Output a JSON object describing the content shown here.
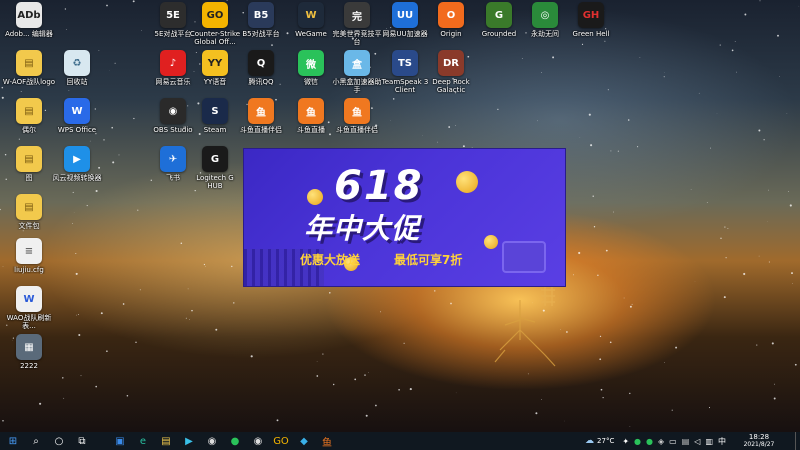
{
  "desktop": {
    "icons": [
      {
        "label": "Adob... 编辑器",
        "color": "#e8e8e8",
        "glyph": "ADb",
        "text": "#222"
      },
      {
        "label": "5E对战平台",
        "color": "#2d2d2d",
        "glyph": "5E",
        "text": "#fff"
      },
      {
        "label": "Counter-Strike Global Off...",
        "color": "#f4b400",
        "glyph": "GO",
        "text": "#222"
      },
      {
        "label": "B5对战平台",
        "color": "#2a3a5a",
        "glyph": "B5",
        "text": "#fff"
      },
      {
        "label": "WeGame",
        "color": "#1e2a3a",
        "glyph": "W",
        "text": "#f0c040"
      },
      {
        "label": "完美世界竞技平台",
        "color": "#3a3a3a",
        "glyph": "完",
        "text": "#fff"
      },
      {
        "label": "网易UU加速器",
        "color": "#1e6fd8",
        "glyph": "UU",
        "text": "#fff"
      },
      {
        "label": "Origin",
        "color": "#f26b1d",
        "glyph": "O",
        "text": "#fff"
      },
      {
        "label": "Grounded",
        "color": "#3a7a2a",
        "glyph": "G",
        "text": "#fff"
      },
      {
        "label": "永劫无间",
        "color": "#2a8a3a",
        "glyph": "◎",
        "text": "#fff"
      },
      {
        "label": "Green Hell",
        "color": "#1a1a1a",
        "glyph": "GH",
        "text": "#e03030"
      },
      {
        "label": "W-AOF战队logo",
        "color": "#f2c94c",
        "glyph": "▤",
        "text": "#7a5a10"
      },
      {
        "label": "回收站",
        "color": "#d8e8f0",
        "glyph": "♻",
        "text": "#3a6a8a"
      },
      {
        "label": "网易云音乐",
        "color": "#e02020",
        "glyph": "♪",
        "text": "#fff"
      },
      {
        "label": "YY语音",
        "color": "#f4c020",
        "glyph": "YY",
        "text": "#222"
      },
      {
        "label": "腾讯QQ",
        "color": "#1a1a1a",
        "glyph": "Q",
        "text": "#fff"
      },
      {
        "label": "微信",
        "color": "#2ac25a",
        "glyph": "微",
        "text": "#fff"
      },
      {
        "label": "小黑盒加速器助手",
        "color": "#6ab8e8",
        "glyph": "盒",
        "text": "#fff"
      },
      {
        "label": "TeamSpeak 3 Client",
        "color": "#2a4a8a",
        "glyph": "TS",
        "text": "#fff"
      },
      {
        "label": "Deep Rock Galactic",
        "color": "#8a3a2a",
        "glyph": "DR",
        "text": "#fff"
      },
      {
        "label": "偶尔",
        "color": "#f2c94c",
        "glyph": "▤",
        "text": "#7a5a10"
      },
      {
        "label": "WPS Office",
        "color": "#2a6ae8",
        "glyph": "W",
        "text": "#fff"
      },
      {
        "label": "OBS Studio",
        "color": "#2a2a2a",
        "glyph": "◉",
        "text": "#fff"
      },
      {
        "label": "Steam",
        "color": "#1a2a4a",
        "glyph": "S",
        "text": "#fff"
      },
      {
        "label": "斗鱼直播伴侣",
        "color": "#f07820",
        "glyph": "鱼",
        "text": "#fff"
      },
      {
        "label": "斗鱼直播",
        "color": "#f07820",
        "glyph": "鱼",
        "text": "#fff"
      },
      {
        "label": "斗鱼直播伴侣",
        "color": "#f07820",
        "glyph": "鱼",
        "text": "#fff"
      },
      {
        "label": "图",
        "color": "#f2c94c",
        "glyph": "▤",
        "text": "#7a5a10"
      },
      {
        "label": "风云视频转换器",
        "color": "#1e90e8",
        "glyph": "▶",
        "text": "#fff"
      },
      {
        "label": "飞书",
        "color": "#1e6fd8",
        "glyph": "✈",
        "text": "#fff"
      },
      {
        "label": "Logitech G HUB",
        "color": "#1a1a1a",
        "glyph": "G",
        "text": "#fff"
      },
      {
        "label": "文件包",
        "color": "#f2c94c",
        "glyph": "▤",
        "text": "#7a5a10"
      },
      {
        "label": "liujiu.cfg",
        "color": "#f0f0f0",
        "glyph": "≡",
        "text": "#666"
      },
      {
        "label": "WAO战队刷新表...",
        "color": "#f0f0f0",
        "glyph": "W",
        "text": "#2a5ad8"
      },
      {
        "label": "2222",
        "color": "#5a6a7a",
        "glyph": "▦",
        "text": "#fff"
      }
    ]
  },
  "ad": {
    "title_line1": "618",
    "title_line2": "年中大促",
    "subtitle_left": "优惠大放送",
    "subtitle_right": "最低可享7折"
  },
  "taskbar": {
    "buttons": [
      {
        "name": "start-button",
        "glyph": "⊞",
        "color": "#4aa0ff"
      },
      {
        "name": "search-button",
        "glyph": "⌕",
        "color": "#ffffff"
      },
      {
        "name": "cortana-button",
        "glyph": "○",
        "color": "#ffffff"
      },
      {
        "name": "task-view-button",
        "glyph": "⧉",
        "color": "#ffffff"
      },
      {
        "name": "store-app",
        "glyph": "▣",
        "color": "#3a8ae8"
      },
      {
        "name": "edge-app",
        "glyph": "e",
        "color": "#2ac0a0"
      },
      {
        "name": "file-explorer-app",
        "glyph": "▤",
        "color": "#f2c94c"
      },
      {
        "name": "media-player-app",
        "glyph": "▶",
        "color": "#3ac0e8"
      },
      {
        "name": "obs-app",
        "glyph": "◉",
        "color": "#dddddd"
      },
      {
        "name": "wechat-app",
        "glyph": "●",
        "color": "#2ac25a"
      },
      {
        "name": "obs-app-2",
        "glyph": "◉",
        "color": "#dddddd"
      },
      {
        "name": "csgo-app",
        "glyph": "GO",
        "color": "#f4b400"
      },
      {
        "name": "app-blue",
        "glyph": "◆",
        "color": "#3ab0e8"
      },
      {
        "name": "douyu-app",
        "glyph": "鱼",
        "color": "#f07820"
      }
    ],
    "weather": "27°C",
    "input_method": "中",
    "clock_time": "18:28",
    "clock_date": "2021/8/27",
    "tray_icons": [
      {
        "name": "tray-bluetooth",
        "glyph": "✦",
        "color": "#ffffff"
      },
      {
        "name": "tray-green",
        "glyph": "●",
        "color": "#2ac25a"
      },
      {
        "name": "tray-wechat",
        "glyph": "●",
        "color": "#2ac25a"
      },
      {
        "name": "tray-shield",
        "glyph": "◈",
        "color": "#cccccc"
      },
      {
        "name": "tray-battery",
        "glyph": "▭",
        "color": "#ffffff"
      },
      {
        "name": "tray-folder",
        "glyph": "▤",
        "color": "#cccccc"
      },
      {
        "name": "tray-volume",
        "glyph": "◁",
        "color": "#ffffff"
      },
      {
        "name": "tray-network",
        "glyph": "▥",
        "color": "#ffffff"
      }
    ]
  }
}
